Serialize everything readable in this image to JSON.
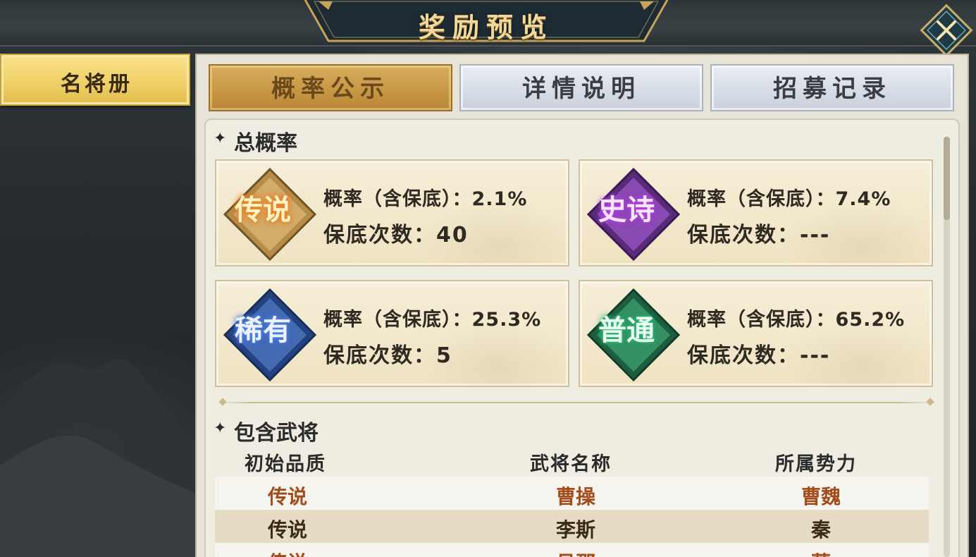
{
  "header": {
    "title": "奖励预览"
  },
  "sidebar": {
    "tab_label": "名将册"
  },
  "tabs": [
    {
      "label": "概率公示",
      "active": true
    },
    {
      "label": "详情说明",
      "active": false
    },
    {
      "label": "招募记录",
      "active": false
    }
  ],
  "total_rate": {
    "title": "总概率",
    "cards": [
      {
        "badge_text": "传说",
        "badge_color": "#e3a33a",
        "line1": "概率（含保底）：2.1%",
        "line2": "保底次数：40"
      },
      {
        "badge_text": "史诗",
        "badge_color": "#9c3cc9",
        "line1": "概率（含保底）：7.4%",
        "line2": "保底次数：---"
      },
      {
        "badge_text": "稀有",
        "badge_color": "#3d62b8",
        "line1": "概率（含保底）：25.3%",
        "line2": "保底次数：5"
      },
      {
        "badge_text": "普通",
        "badge_color": "#2f9a63",
        "line1": "概率（含保底）：65.2%",
        "line2": "保底次数：---"
      }
    ]
  },
  "generals": {
    "title": "包含武将",
    "headers": [
      "初始品质",
      "武将名称",
      "所属势力"
    ],
    "rows": [
      {
        "quality": "传说",
        "name": "曹操",
        "faction": "曹魏",
        "color": "#a34d1c"
      },
      {
        "quality": "传说",
        "name": "李斯",
        "faction": "秦",
        "color": "#3a2a18"
      },
      {
        "quality": "传说",
        "name": "吕邵",
        "faction": "蒙",
        "color": "#a34d1c"
      }
    ]
  }
}
